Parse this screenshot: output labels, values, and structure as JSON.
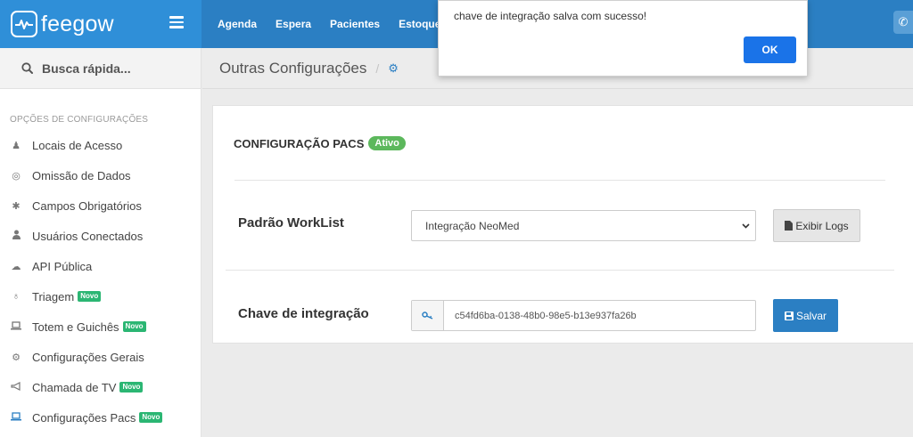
{
  "brand": {
    "name": "feegow"
  },
  "topnav": {
    "items": [
      "Agenda",
      "Espera",
      "Pacientes",
      "Estoque"
    ]
  },
  "sidebar": {
    "search_label": "Busca rápida...",
    "heading": "OPÇÕES DE CONFIGURAÇÕES",
    "new_badge": "Novo",
    "items": [
      {
        "label": "Locais de Acesso",
        "icon": "map-marker-icon"
      },
      {
        "label": "Omissão de Dados",
        "icon": "eye-slash-icon"
      },
      {
        "label": "Campos Obrigatórios",
        "icon": "asterisk-icon"
      },
      {
        "label": "Usuários Conectados",
        "icon": "user-icon"
      },
      {
        "label": "API Pública",
        "icon": "cloud-icon"
      },
      {
        "label": "Triagem",
        "icon": "stethoscope-icon",
        "new": true
      },
      {
        "label": "Totem e Guichês",
        "icon": "laptop-icon",
        "new": true
      },
      {
        "label": "Configurações Gerais",
        "icon": "cogs-icon"
      },
      {
        "label": "Chamada de TV",
        "icon": "bullhorn-icon",
        "new": true
      },
      {
        "label": "Configurações Pacs",
        "icon": "laptop-icon",
        "new": true
      }
    ]
  },
  "breadcrumb": {
    "title": "Outras Configurações"
  },
  "pacs": {
    "title": "CONFIGURAÇÃO PACS",
    "status": "Ativo",
    "worklist_label": "Padrão WorkList",
    "worklist_value": "Integração NeoMed",
    "logs_button": "Exibir Logs",
    "key_label": "Chave de integração",
    "key_value": "c54fd6ba-0138-48b0-98e5-b13e937fa26b",
    "save_button": "Salvar"
  },
  "dialog": {
    "message": "chave de integração salva com sucesso!",
    "ok_button": "OK"
  },
  "colors": {
    "topbar": "#2b7fc3",
    "brand": "#2f8fd8",
    "badge_new": "#2bb673",
    "badge_active": "#5cb85c",
    "ok_button": "#1a73e8"
  }
}
